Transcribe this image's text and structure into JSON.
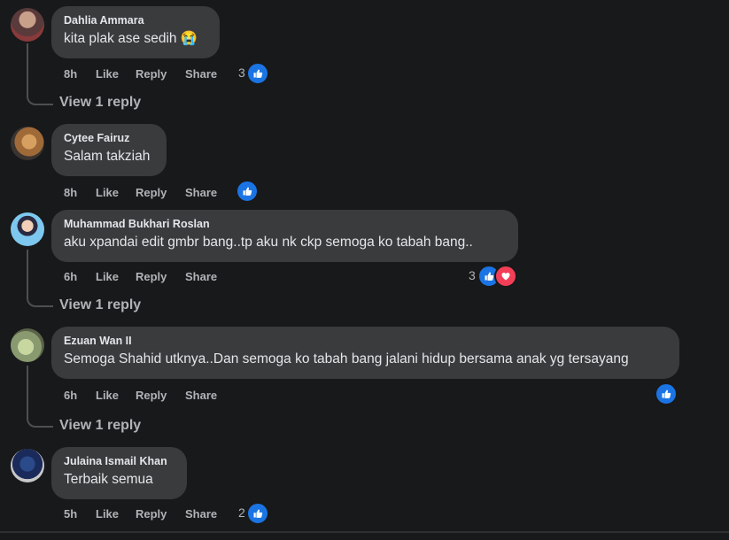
{
  "labels": {
    "like": "Like",
    "reply": "Reply",
    "share": "Share"
  },
  "comments": [
    {
      "author": "Dahlia Ammara",
      "text": "kita plak ase sedih 😭",
      "time": "8h",
      "reaction_count": "3",
      "reactions": [
        "like-icon"
      ],
      "view_replies": "View 1 reply"
    },
    {
      "author": "Cytee Fairuz",
      "text": "Salam takziah",
      "time": "8h",
      "reaction_count": "",
      "reactions": [
        "like-icon"
      ]
    },
    {
      "author": "Muhammad Bukhari Roslan",
      "text": "aku xpandai edit gmbr bang..tp aku nk ckp semoga ko tabah bang..",
      "time": "6h",
      "reaction_count": "3",
      "reactions": [
        "like-icon",
        "heart-icon"
      ],
      "view_replies": "View 1 reply"
    },
    {
      "author": "Ezuan Wan II",
      "text": "Semoga Shahid utknya..Dan semoga ko tabah bang jalani hidup bersama anak yg tersayang",
      "time": "6h",
      "reaction_count": "",
      "reactions": [
        "like-icon"
      ],
      "view_replies": "View 1 reply"
    },
    {
      "author": "Julaina Ismail Khan",
      "text": "Terbaik semua",
      "time": "5h",
      "reaction_count": "2",
      "reactions": [
        "like-icon"
      ]
    }
  ],
  "colors": {
    "background": "#18191a",
    "bubble": "#3a3b3c",
    "like_blue": "#1b74e4",
    "heart_red": "#f33e58",
    "secondary_text": "#b0b3b8"
  }
}
